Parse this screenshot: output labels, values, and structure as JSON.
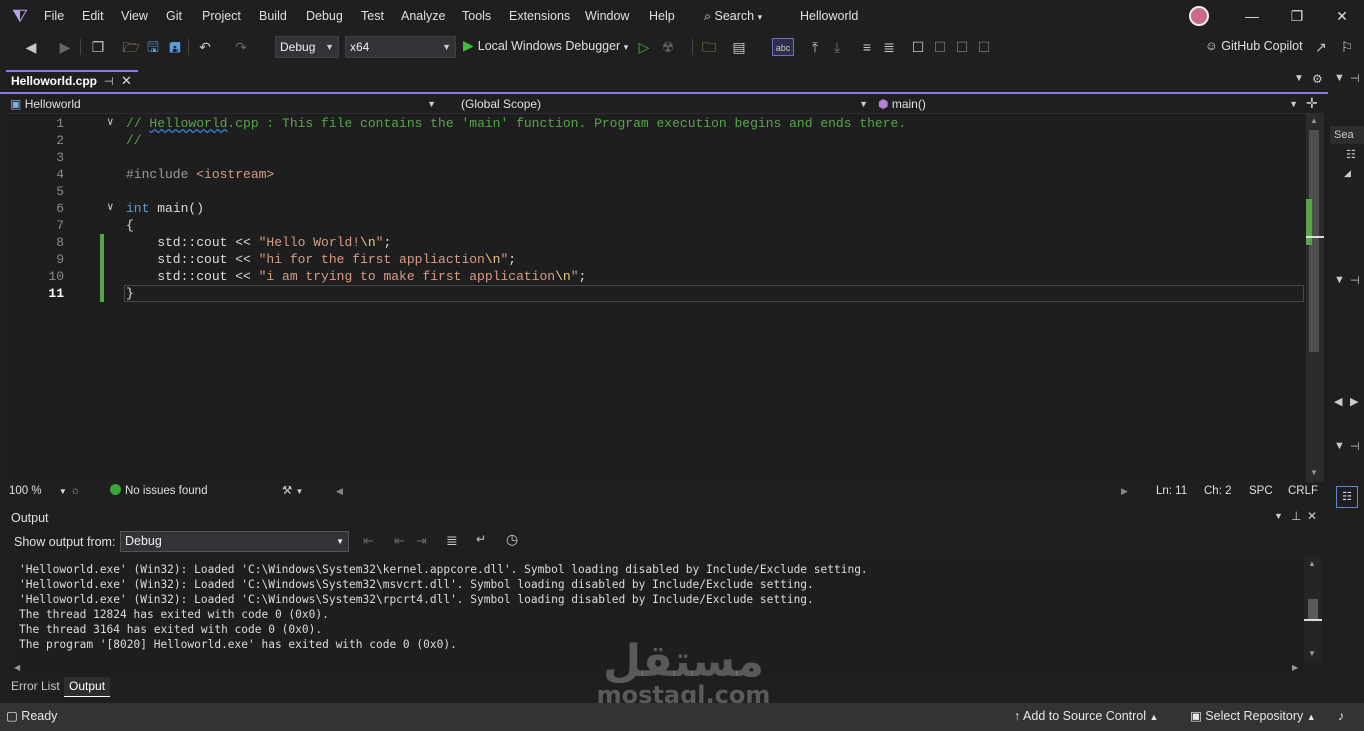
{
  "titlebar": {
    "menus": [
      "File",
      "Edit",
      "View",
      "Git",
      "Project",
      "Build",
      "Debug",
      "Test",
      "Analyze",
      "Tools",
      "Extensions",
      "Window",
      "Help"
    ],
    "search_label": "Search",
    "project_name": "Helloworld"
  },
  "toolbar": {
    "configuration": "Debug",
    "platform": "x64",
    "run_label": "Local Windows Debugger",
    "copilot_label": "GitHub Copilot"
  },
  "document": {
    "tab_title": "Helloworld.cpp",
    "nav_project": "Helloworld",
    "nav_scope": "(Global Scope)",
    "nav_member": "main()"
  },
  "code_lines": [
    {
      "num": "1",
      "tokens": [
        {
          "t": "// ",
          "c": "cm"
        },
        {
          "t": "Helloworld",
          "c": "cm"
        },
        {
          "t": ".cpp : This file contains the 'main' function. Program execution begins and ends there.",
          "c": "cm"
        }
      ]
    },
    {
      "num": "2",
      "tokens": [
        {
          "t": "//",
          "c": "cm"
        }
      ]
    },
    {
      "num": "3",
      "tokens": []
    },
    {
      "num": "4",
      "tokens": [
        {
          "t": "#include ",
          "c": "pp"
        },
        {
          "t": "<iostream>",
          "c": "str"
        }
      ]
    },
    {
      "num": "5",
      "tokens": []
    },
    {
      "num": "6",
      "tokens": [
        {
          "t": "int ",
          "c": "kw"
        },
        {
          "t": "main()",
          "c": "id"
        }
      ]
    },
    {
      "num": "7",
      "tokens": [
        {
          "t": "{",
          "c": "id"
        }
      ]
    },
    {
      "num": "8",
      "tokens": [
        {
          "t": "    std::cout << ",
          "c": "id"
        },
        {
          "t": "\"Hello World!",
          "c": "str"
        },
        {
          "t": "\\n",
          "c": "esc"
        },
        {
          "t": "\"",
          "c": "str"
        },
        {
          "t": ";",
          "c": "id"
        }
      ]
    },
    {
      "num": "9",
      "tokens": [
        {
          "t": "    std::cout << ",
          "c": "id"
        },
        {
          "t": "\"hi for the first appliaction",
          "c": "str"
        },
        {
          "t": "\\n",
          "c": "esc"
        },
        {
          "t": "\"",
          "c": "str"
        },
        {
          "t": ";",
          "c": "id"
        }
      ]
    },
    {
      "num": "10",
      "tokens": [
        {
          "t": "    std::cout << ",
          "c": "id"
        },
        {
          "t": "\"i am trying to make first application",
          "c": "str"
        },
        {
          "t": "\\n",
          "c": "esc"
        },
        {
          "t": "\"",
          "c": "str"
        },
        {
          "t": ";",
          "c": "id"
        }
      ]
    },
    {
      "num": "11",
      "tokens": [
        {
          "t": "}",
          "c": "id"
        }
      ]
    }
  ],
  "editor_status": {
    "zoom": "100 %",
    "issues": "No issues found",
    "line": "Ln: 11",
    "col": "Ch: 2",
    "whitespace": "SPC",
    "line_ending": "CRLF"
  },
  "output": {
    "title": "Output",
    "show_from_label": "Show output from:",
    "source": "Debug",
    "lines": [
      "'Helloworld.exe' (Win32): Loaded 'C:\\Windows\\System32\\kernel.appcore.dll'. Symbol loading disabled by Include/Exclude setting.",
      "'Helloworld.exe' (Win32): Loaded 'C:\\Windows\\System32\\msvcrt.dll'. Symbol loading disabled by Include/Exclude setting.",
      "'Helloworld.exe' (Win32): Loaded 'C:\\Windows\\System32\\rpcrt4.dll'. Symbol loading disabled by Include/Exclude setting.",
      "The thread 12824 has exited with code 0 (0x0).",
      "The thread 3164 has exited with code 0 (0x0).",
      "The program '[8020] Helloworld.exe' has exited with code 0 (0x0)."
    ]
  },
  "bottom_tabs": [
    "Error List",
    "Output"
  ],
  "statusbar": {
    "state": "Ready",
    "source_control": "Add to Source Control",
    "repository": "Select Repository"
  },
  "right_strip": {
    "search_hint": "Sea"
  },
  "watermark": {
    "arabic": "مستقل",
    "latin": "mostaql.com"
  },
  "colors": {
    "accent": "#8a7bd8",
    "change_marker": "#57a64a",
    "comment": "#57a64a",
    "keyword": "#569cd6",
    "string": "#d69d85"
  }
}
